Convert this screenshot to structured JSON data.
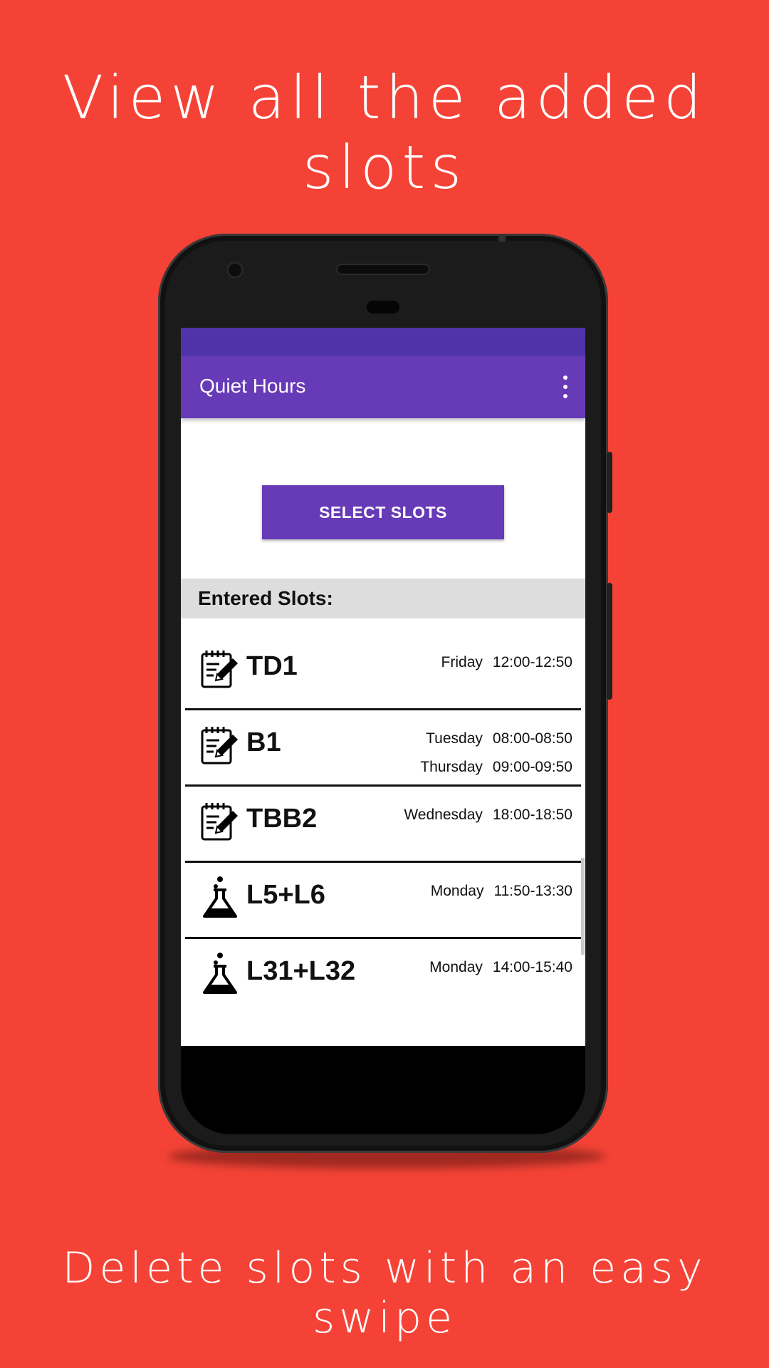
{
  "promo": {
    "top_text": "View all the added slots",
    "bottom_text": "Delete slots with an easy swipe"
  },
  "colors": {
    "background": "#F44336",
    "primary": "#673AB7",
    "primary_dark": "#5133A9"
  },
  "app": {
    "title": "Quiet Hours",
    "overflow_icon": "more-vert-icon",
    "select_button_label": "SELECT SLOTS",
    "section_header": "Entered Slots:"
  },
  "slots": [
    {
      "icon": "notepad-pencil-icon",
      "name": "TD1",
      "times": [
        {
          "day": "Friday",
          "range": "12:00-12:50"
        }
      ]
    },
    {
      "icon": "notepad-pencil-icon",
      "name": "B1",
      "times": [
        {
          "day": "Tuesday",
          "range": "08:00-08:50"
        },
        {
          "day": "Thursday",
          "range": "09:00-09:50"
        }
      ]
    },
    {
      "icon": "notepad-pencil-icon",
      "name": "TBB2",
      "times": [
        {
          "day": "Wednesday",
          "range": "18:00-18:50"
        }
      ]
    },
    {
      "icon": "lab-flask-icon",
      "name": "L5+L6",
      "times": [
        {
          "day": "Monday",
          "range": "11:50-13:30"
        }
      ]
    },
    {
      "icon": "lab-flask-icon",
      "name": "L31+L32",
      "times": [
        {
          "day": "Monday",
          "range": "14:00-15:40"
        }
      ]
    }
  ]
}
